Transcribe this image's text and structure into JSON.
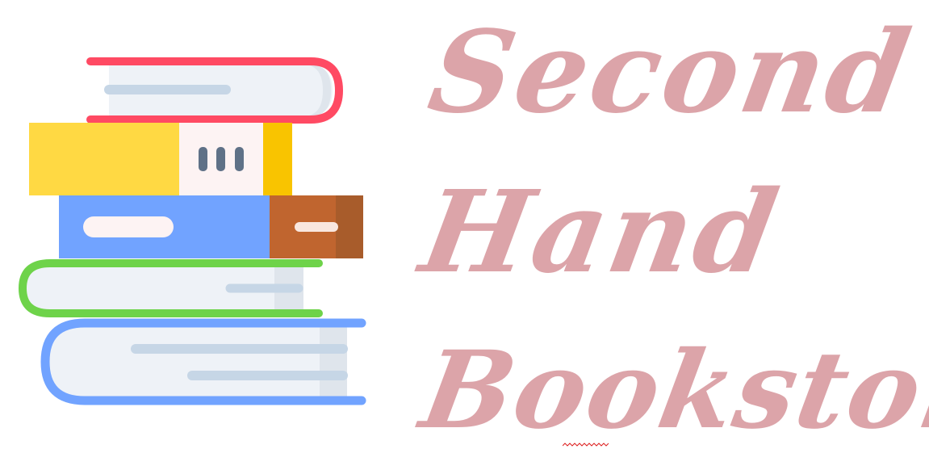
{
  "title": {
    "line1": "Second",
    "line2": "Hand",
    "line3": "Bookstore"
  },
  "logo": {
    "icon": "book-stack-icon"
  },
  "colors": {
    "title_text": "#dca4a9",
    "book_red": "#ff4a63",
    "book_yellow": "#ffd943",
    "book_blue": "#71a3ff",
    "book_brown": "#c0652f",
    "book_green": "#6ed34a",
    "book_bottom_blue": "#71a3ff",
    "page_white": "#eef2f7",
    "spellcheck": "#d22"
  }
}
